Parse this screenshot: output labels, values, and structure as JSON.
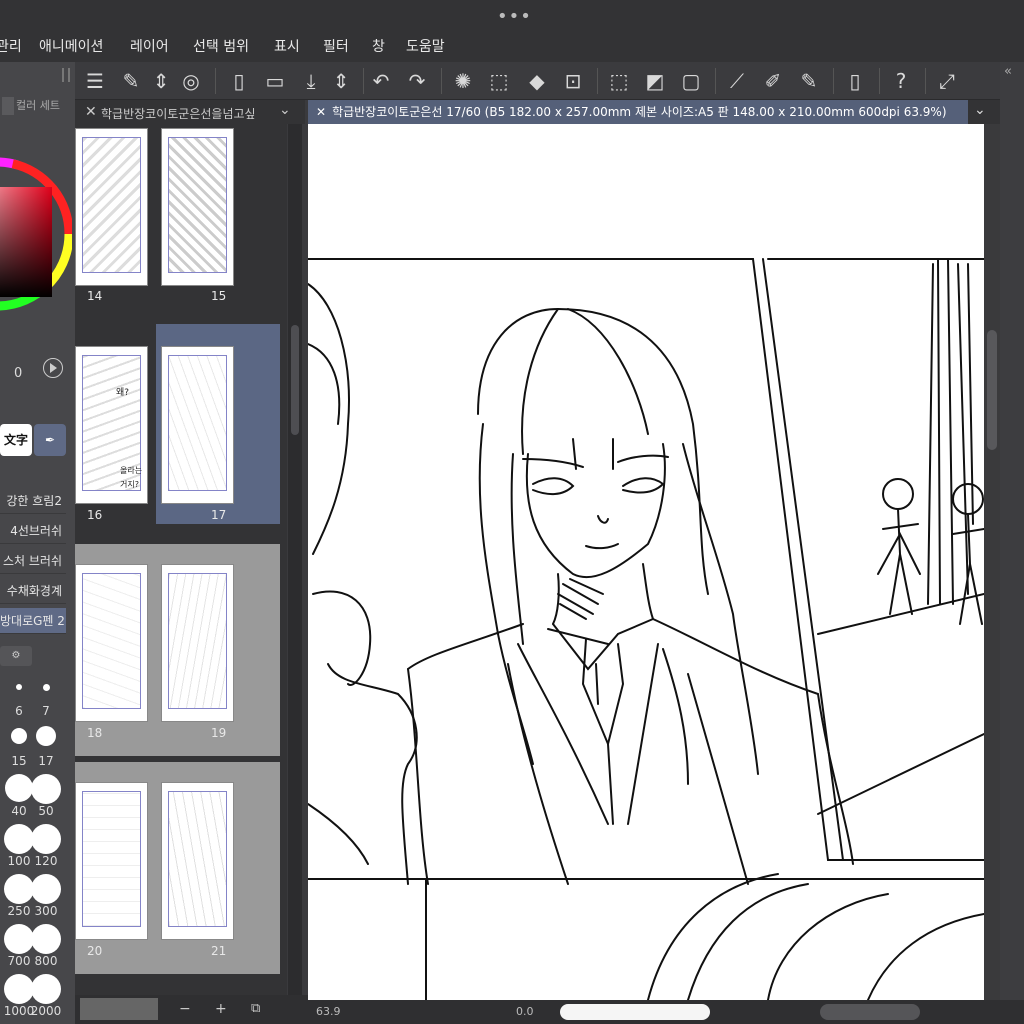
{
  "window": {
    "dots": "•••"
  },
  "menu": [
    "관리",
    "애니메이션",
    "레이어",
    "선택 범위",
    "표시",
    "필터",
    "창",
    "도움말"
  ],
  "color_panel": {
    "tabs": [
      "",
      "컬러 세트"
    ],
    "value_label": "0",
    "wheel_hint": "hue-wheel"
  },
  "tool_buttons": [
    "文字",
    "pen"
  ],
  "brush_list": [
    {
      "label": "강한 흐림2",
      "active": false
    },
    {
      "label": "4선브러쉬",
      "active": false
    },
    {
      "label": "스처 브러쉬",
      "active": false
    },
    {
      "label": "수채화경계",
      "active": false
    },
    {
      "label": "방대로G펜 2",
      "active": true
    }
  ],
  "brush_sizes": [
    "6",
    "7",
    "15",
    "17",
    "40",
    "50",
    "100",
    "120",
    "250",
    "300",
    "700",
    "800",
    "1000",
    "2000"
  ],
  "pages_tab": {
    "title": "학급반장코이토군은선을넘고싶"
  },
  "pages": {
    "rows": [
      {
        "left": "14",
        "right": "15"
      },
      {
        "left": "16",
        "right": "17"
      },
      {
        "left": "18",
        "right": "19"
      },
      {
        "left": "20",
        "right": "21"
      }
    ],
    "selected": "17",
    "speech_lines": [
      "왜?",
      "올라는",
      "거지?"
    ]
  },
  "canvas_tab": {
    "title": "학급반장코이토군은선 17/60 (B5 182.00 x 257.00mm 제본 사이즈:A5 판 148.00 x 210.00mm 600dpi 63.9%)"
  },
  "bottom": {
    "zoom": "63.9",
    "angle": "0.0",
    "minus": "−",
    "plus": "+"
  },
  "colors": {
    "accent_tab": "#556079",
    "active_brush": "#5f6a86",
    "selected_spread": "#5b6784"
  }
}
